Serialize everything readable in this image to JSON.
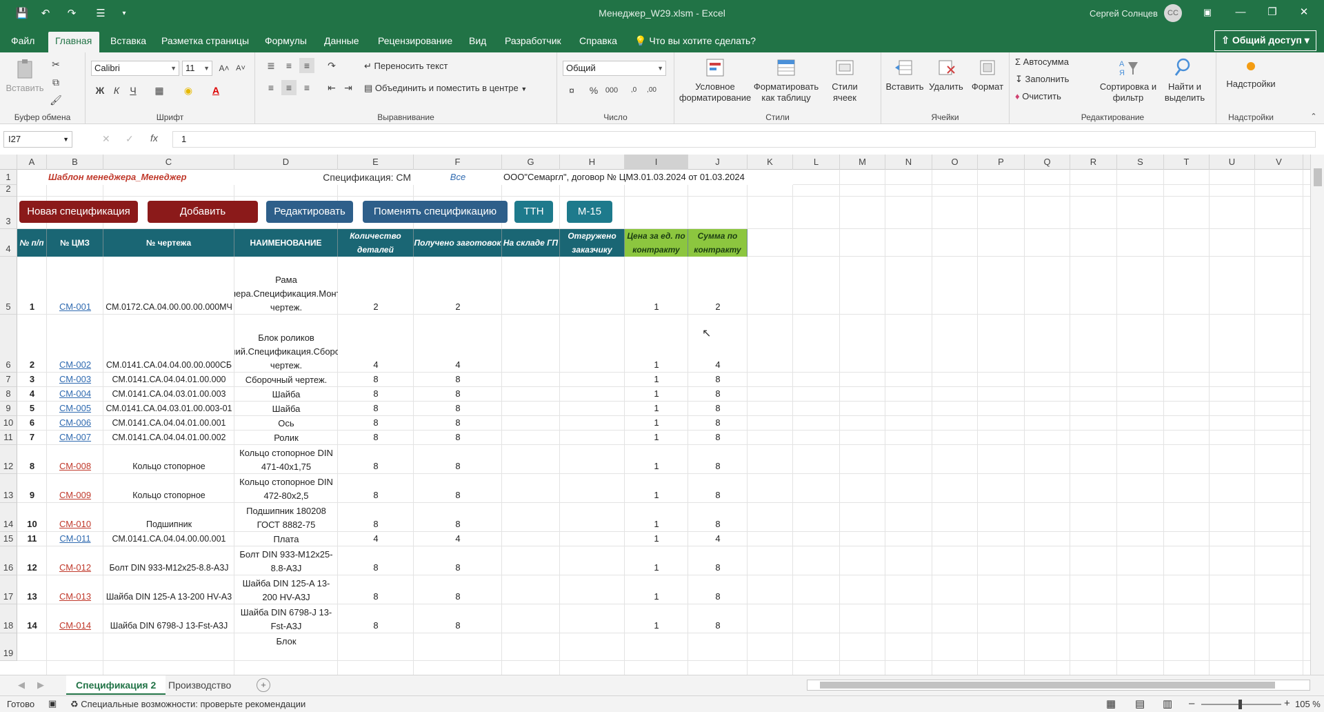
{
  "titlebar": {
    "title": "Менеджер_W29.xlsm  -  Excel",
    "user": "Сергей Солнцев",
    "avatar": "СС"
  },
  "ribbon_tabs": [
    "Файл",
    "Главная",
    "Вставка",
    "Разметка страницы",
    "Формулы",
    "Данные",
    "Рецензирование",
    "Вид",
    "Разработчик",
    "Справка"
  ],
  "tell_me": "Что вы хотите сделать?",
  "share": "Общий доступ",
  "clipboard": {
    "paste": "Вставить",
    "group": "Буфер обмена"
  },
  "font": {
    "name": "Calibri",
    "size": "11",
    "group": "Шрифт",
    "bold": "Ж",
    "italic": "К",
    "underline": "Ч"
  },
  "alignment": {
    "wrap": "Переносить текст",
    "merge": "Объединить и поместить в центре",
    "group": "Выравнивание"
  },
  "number": {
    "format": "Общий",
    "group": "Число"
  },
  "styles": {
    "cond": "Условное форматирование",
    "table": "Форматировать как таблицу",
    "cell": "Стили ячеек",
    "group": "Стили"
  },
  "cells": {
    "insert": "Вставить",
    "delete": "Удалить",
    "format": "Формат",
    "group": "Ячейки"
  },
  "editing": {
    "autosum": "Автосумма",
    "fill": "Заполнить",
    "clear": "Очистить",
    "sort": "Сортировка и фильтр",
    "find": "Найти и выделить",
    "group": "Редактирование"
  },
  "addins": {
    "label": "Надстройки",
    "group": "Надстройки"
  },
  "formula_bar": {
    "name": "I27",
    "value": "1",
    "fx": "fx"
  },
  "columns": [
    "A",
    "B",
    "C",
    "D",
    "E",
    "F",
    "G",
    "H",
    "I",
    "J",
    "K",
    "L",
    "M",
    "N",
    "O",
    "P",
    "Q",
    "R",
    "S",
    "T",
    "U",
    "V"
  ],
  "sheet": {
    "template_title": "Шаблон менеджера_Менеджер",
    "spec_label": "Спецификация: СМ",
    "all": "Все",
    "contract": "ООО\"Семаргл\", договор № ЦМЗ.01.03.2024 от 01.03.2024",
    "buttons": [
      "Новая спецификация",
      "Добавить",
      "Редактировать",
      "Поменять спецификацию",
      "ТТН",
      "М-15"
    ],
    "headers": [
      "№ п/п",
      "№ ЦМЗ",
      "№ чертежа",
      "НАИМЕНОВАНИЕ",
      "Количество деталей",
      "Получено заготовок",
      "На складе ГП",
      "Отгружено заказчику",
      "Цена за ед. по контракту",
      "Сумма по контракту"
    ],
    "rows": [
      {
        "rn": "5",
        "n": "1",
        "cmz": "СМ-001",
        "dr": "СМ.0172.СА.04.00.00.00.000МЧ",
        "name": "Рама штабелера.Спецификация.Монтажный чертеж.",
        "q": "2",
        "g": "2",
        "p": "1",
        "s": "2"
      },
      {
        "rn": "6",
        "n": "2",
        "cmz": "СМ-002",
        "dr": "СМ.0141.СА.04.04.00.00.000СБ",
        "name": "Блок роликов верхний.Спецификация.Сборочный чертеж.",
        "q": "4",
        "g": "4",
        "p": "1",
        "s": "4"
      },
      {
        "rn": "7",
        "n": "3",
        "cmz": "СМ-003",
        "dr": "СМ.0141.СА.04.04.01.00.000",
        "name": "Ролик.Спецификация. Сборочный чертеж.",
        "q": "8",
        "g": "8",
        "p": "1",
        "s": "8"
      },
      {
        "rn": "8",
        "n": "4",
        "cmz": "СМ-004",
        "dr": "СМ.0141.СА.04.03.01.00.003",
        "name": "Шайба",
        "q": "8",
        "g": "8",
        "p": "1",
        "s": "8"
      },
      {
        "rn": "9",
        "n": "5",
        "cmz": "СМ-005",
        "dr": "СМ.0141.СА.04.03.01.00.003-01",
        "name": "Шайба",
        "q": "8",
        "g": "8",
        "p": "1",
        "s": "8"
      },
      {
        "rn": "10",
        "n": "6",
        "cmz": "СМ-006",
        "dr": "СМ.0141.СА.04.04.01.00.001",
        "name": "Ось",
        "q": "8",
        "g": "8",
        "p": "1",
        "s": "8"
      },
      {
        "rn": "11",
        "n": "7",
        "cmz": "СМ-007",
        "dr": "СМ.0141.СА.04.04.01.00.002",
        "name": "Ролик",
        "q": "8",
        "g": "8",
        "p": "1",
        "s": "8"
      },
      {
        "rn": "12",
        "n": "8",
        "cmz": "СМ-008",
        "dr": "Кольцо стопорное",
        "name": "Кольцо стопорное DIN 471-40x1,75",
        "q": "8",
        "g": "8",
        "p": "1",
        "s": "8"
      },
      {
        "rn": "13",
        "n": "9",
        "cmz": "СМ-009",
        "dr": "Кольцо стопорное",
        "name": "Кольцо стопорное DIN 472-80x2,5",
        "q": "8",
        "g": "8",
        "p": "1",
        "s": "8"
      },
      {
        "rn": "14",
        "n": "10",
        "cmz": "СМ-010",
        "dr": "Подшипник",
        "name": "Подшипник 180208 ГОСТ 8882-75",
        "q": "8",
        "g": "8",
        "p": "1",
        "s": "8"
      },
      {
        "rn": "15",
        "n": "11",
        "cmz": "СМ-011",
        "dr": "СМ.0141.СА.04.04.00.00.001",
        "name": "Плата",
        "q": "4",
        "g": "4",
        "p": "1",
        "s": "4"
      },
      {
        "rn": "16",
        "n": "12",
        "cmz": "СМ-012",
        "dr": "Болт DIN 933-M12x25-8.8-A3J",
        "name": "Болт DIN 933-M12x25-8.8-A3J",
        "q": "8",
        "g": "8",
        "p": "1",
        "s": "8"
      },
      {
        "rn": "17",
        "n": "13",
        "cmz": "СМ-013",
        "dr": "Шайба DIN 125-A 13-200 HV-A3",
        "name": "Шайба DIN 125-A 13-200 HV-A3J",
        "q": "8",
        "g": "8",
        "p": "1",
        "s": "8"
      },
      {
        "rn": "18",
        "n": "14",
        "cmz": "СМ-014",
        "dr": "Шайба DIN 6798-J 13-Fst-A3J",
        "name": "Шайба DIN 6798-J 13-Fst-A3J",
        "q": "8",
        "g": "8",
        "p": "1",
        "s": "8"
      }
    ],
    "partial_name": "Блок"
  },
  "sheet_tabs": [
    "Спецификация 2",
    "Производство"
  ],
  "status": {
    "ready": "Готово",
    "accessibility": "Специальные возможности: проверьте рекомендации",
    "zoom": "105 %"
  },
  "colors": {
    "green": "#217346",
    "button_red": "#8b1a1a",
    "button_blue": "#2e5f8a",
    "button_teal": "#1e7a8c",
    "header_teal": "#1a6674",
    "header_green": "#8cc63f"
  }
}
